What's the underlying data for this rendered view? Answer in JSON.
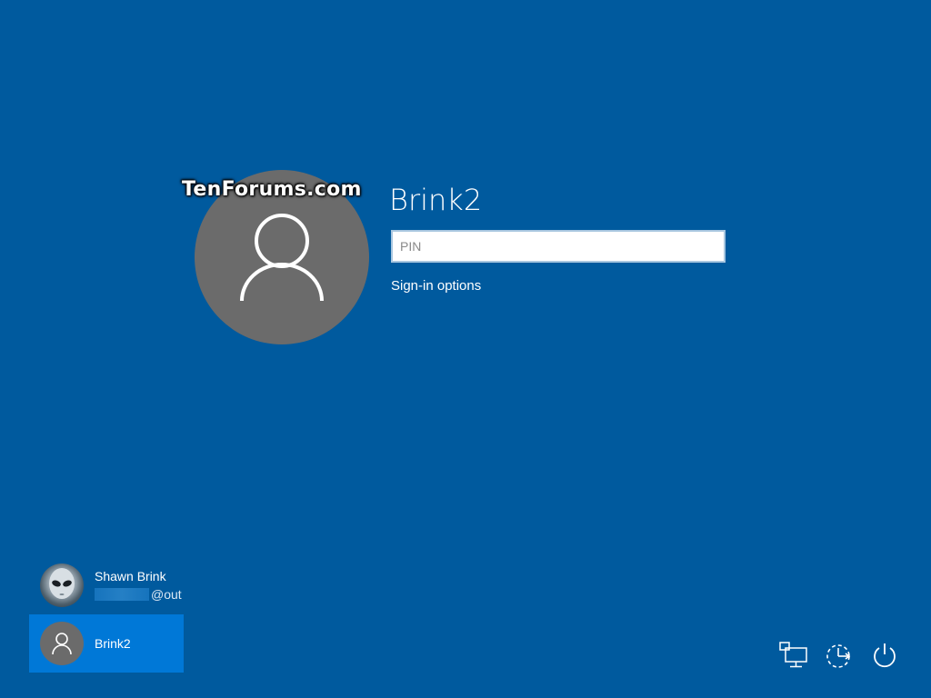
{
  "watermark": "TenForums.com",
  "current_user": {
    "name": "Brink2",
    "pin_placeholder": "PIN",
    "signin_options_label": "Sign-in options",
    "avatar_icon": "user-icon"
  },
  "user_list": [
    {
      "name": "Shawn Brink",
      "email_suffix": "@out",
      "avatar": "alien-photo"
    },
    {
      "name": "Brink2",
      "avatar": "user-icon",
      "selected": true
    }
  ],
  "corner_icons": [
    "network-icon",
    "ease-of-access-icon",
    "power-icon"
  ],
  "colors": {
    "background": "#005a9e",
    "selected_user": "#0078d7",
    "avatar_gray": "#6b6b6b"
  }
}
